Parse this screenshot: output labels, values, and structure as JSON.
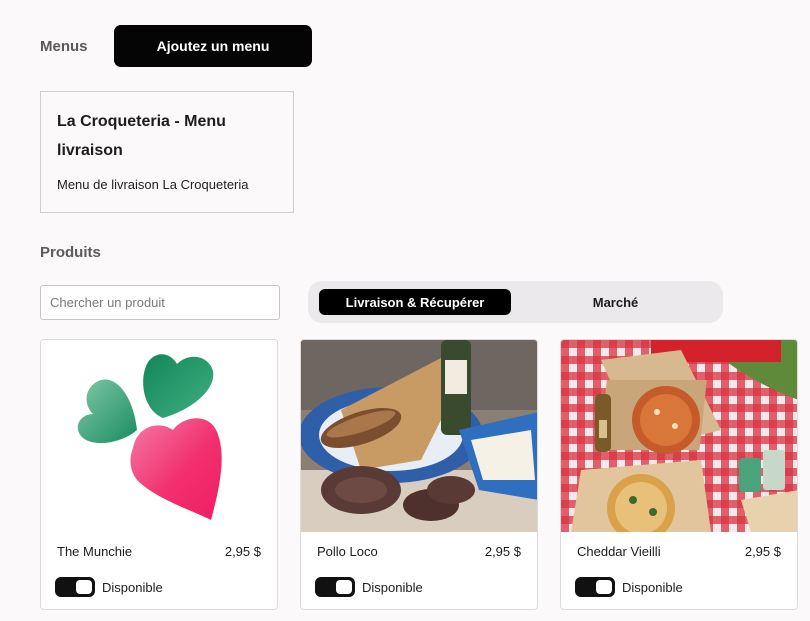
{
  "menus": {
    "section_label": "Menus",
    "add_button_label": "Ajoutez un menu",
    "items": [
      {
        "title": "La Croqueteria - Menu livraison",
        "description": "Menu de livraison La Croqueteria"
      }
    ]
  },
  "products": {
    "section_label": "Produits",
    "search": {
      "placeholder": "Chercher un produit",
      "value": ""
    },
    "tabs": [
      {
        "label": "Livraison & Récupérer",
        "active": true
      },
      {
        "label": "Marché",
        "active": false
      }
    ],
    "items": [
      {
        "name": "The Munchie",
        "price": "2,95 $",
        "availability_label": "Disponible",
        "available": true,
        "image_icon": "radish-logo-icon"
      },
      {
        "name": "Pollo Loco",
        "price": "2,95 $",
        "availability_label": "Disponible",
        "available": true,
        "image_icon": "charcuterie-photo"
      },
      {
        "name": "Cheddar Vieilli",
        "price": "2,95 $",
        "availability_label": "Disponible",
        "available": true,
        "image_icon": "pizza-picnic-photo"
      }
    ]
  },
  "colors": {
    "primary": "#050505",
    "page_background": "#fbf9fa",
    "tab_bar_background": "#ebe9eb",
    "radish_pink": "#f2306f",
    "radish_green": "#1a8a5f"
  }
}
